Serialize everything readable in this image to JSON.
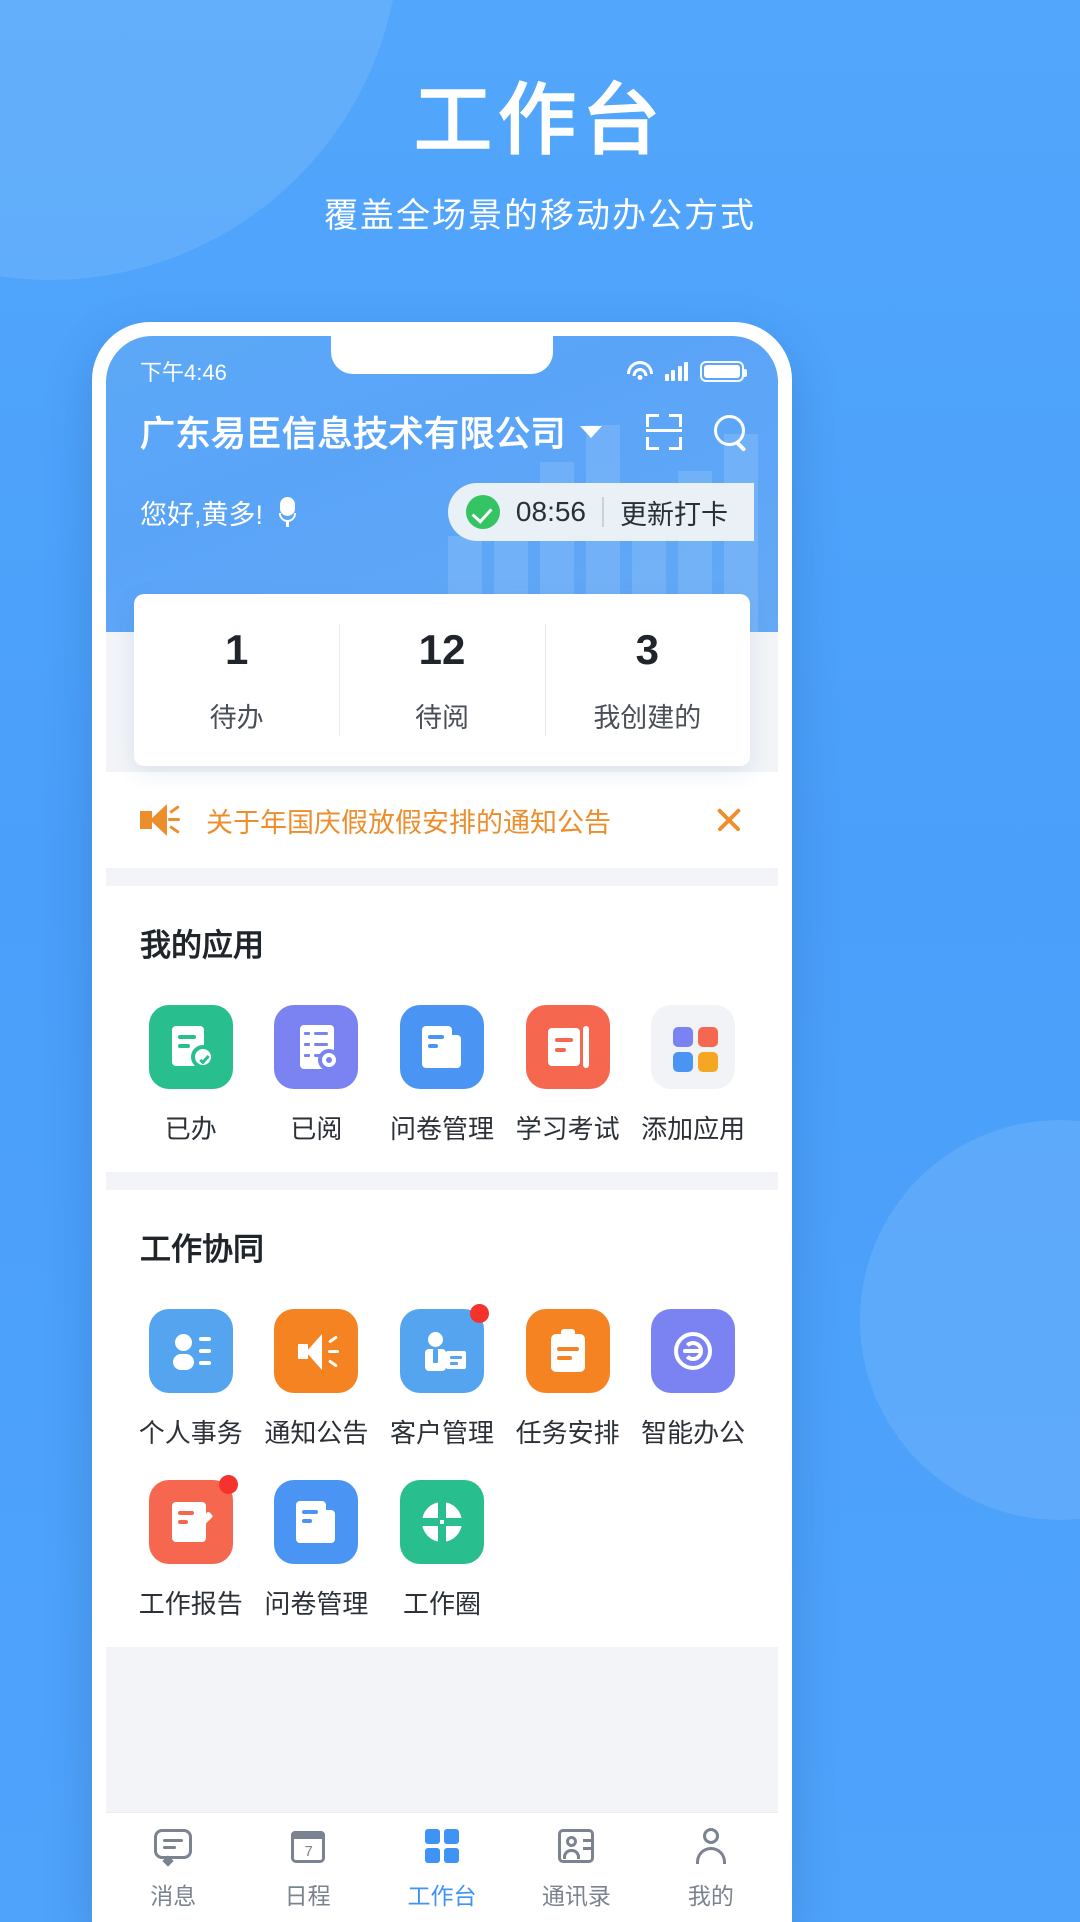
{
  "promo": {
    "title": "工作台",
    "subtitle": "覆盖全场景的移动办公方式"
  },
  "colors": {
    "brand_blue": "#4da2fa",
    "accent_orange": "#ed8e2c",
    "success_green": "#35c463",
    "badge_red": "#f5322c",
    "active_tab": "#3f93f5"
  },
  "statusbar": {
    "time": "下午4:46",
    "wifi_icon": "wifi-icon",
    "signal_icon": "signal-bars-icon",
    "battery_icon": "battery-icon"
  },
  "header": {
    "company": "广东易臣信息技术有限公司",
    "caret_icon": "chevron-down-icon",
    "scan_icon": "scan-qr-icon",
    "search_icon": "search-icon",
    "greeting": "您好,黄多!",
    "mic_icon": "microphone-icon",
    "punch": {
      "status_icon": "check-circle-icon",
      "time": "08:56",
      "action": "更新打卡"
    }
  },
  "stats": [
    {
      "value": "1",
      "label": "待办"
    },
    {
      "value": "12",
      "label": "待阅"
    },
    {
      "value": "3",
      "label": "我创建的"
    }
  ],
  "notice": {
    "icon": "megaphone-icon",
    "text": "关于年国庆假放假安排的通知公告",
    "close_icon": "close-icon"
  },
  "my_apps": {
    "title": "我的应用",
    "items": [
      {
        "label": "已办",
        "icon": "doc-check-icon",
        "color": "#28be8d",
        "badge": false
      },
      {
        "label": "已阅",
        "icon": "checklist-icon",
        "color": "#7b82f2",
        "badge": false
      },
      {
        "label": "问卷管理",
        "icon": "survey-doc-icon",
        "color": "#4a94f3",
        "badge": false
      },
      {
        "label": "学习考试",
        "icon": "book-exam-icon",
        "color": "#f5684f",
        "badge": false
      },
      {
        "label": "添加应用",
        "icon": "add-apps-icon",
        "color": "#f1f3f6",
        "badge": false
      }
    ]
  },
  "collaboration": {
    "title": "工作协同",
    "items": [
      {
        "label": "个人事务",
        "icon": "person-card-icon",
        "color": "#54a4f0",
        "badge": false
      },
      {
        "label": "通知公告",
        "icon": "megaphone-icon",
        "color": "#f58322",
        "badge": false
      },
      {
        "label": "客户管理",
        "icon": "customer-icon",
        "color": "#54a4f0",
        "badge": true
      },
      {
        "label": "任务安排",
        "icon": "clipboard-icon",
        "color": "#f58322",
        "badge": false
      },
      {
        "label": "智能办公",
        "icon": "layers-icon",
        "color": "#7b82f2",
        "badge": false
      },
      {
        "label": "工作报告",
        "icon": "report-edit-icon",
        "color": "#f5684f",
        "badge": true
      },
      {
        "label": "问卷管理",
        "icon": "survey-doc-icon",
        "color": "#4a94f3",
        "badge": false
      },
      {
        "label": "工作圈",
        "icon": "circle-share-icon",
        "color": "#28be8d",
        "badge": false
      }
    ]
  },
  "bottomnav": [
    {
      "label": "消息",
      "icon": "message-icon",
      "active": false
    },
    {
      "label": "日程",
      "icon": "calendar-icon",
      "active": false
    },
    {
      "label": "工作台",
      "icon": "grid-apps-icon",
      "active": true
    },
    {
      "label": "通讯录",
      "icon": "contacts-icon",
      "active": false
    },
    {
      "label": "我的",
      "icon": "person-icon",
      "active": false
    }
  ]
}
